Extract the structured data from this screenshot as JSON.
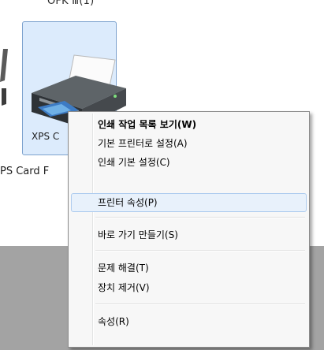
{
  "devices": {
    "top_label": "OFK Ⅲ(1)",
    "selected_tile_label": "XPS C",
    "below_label": "PS Card F"
  },
  "context_menu": {
    "items": [
      {
        "label": "인쇄 작업 목록 보기(W)"
      },
      {
        "label": "기본 프린터로 설정(A)"
      },
      {
        "label": "인쇄 기본 설정(C)"
      },
      {
        "label": "프린터 속성(P)"
      },
      {
        "label": "바로 가기 만들기(S)"
      },
      {
        "label": "문제 해결(T)"
      },
      {
        "label": "장치 제거(V)"
      },
      {
        "label": "속성(R)"
      }
    ]
  },
  "colors": {
    "tile_bg": "#dcebfc",
    "tile_border": "#7da2ce",
    "menu_bg": "#f7f7f7",
    "menu_highlight_bg": "#e8f1fb",
    "menu_highlight_border": "#aeccef",
    "bottom_area": "#a3a3a3"
  }
}
